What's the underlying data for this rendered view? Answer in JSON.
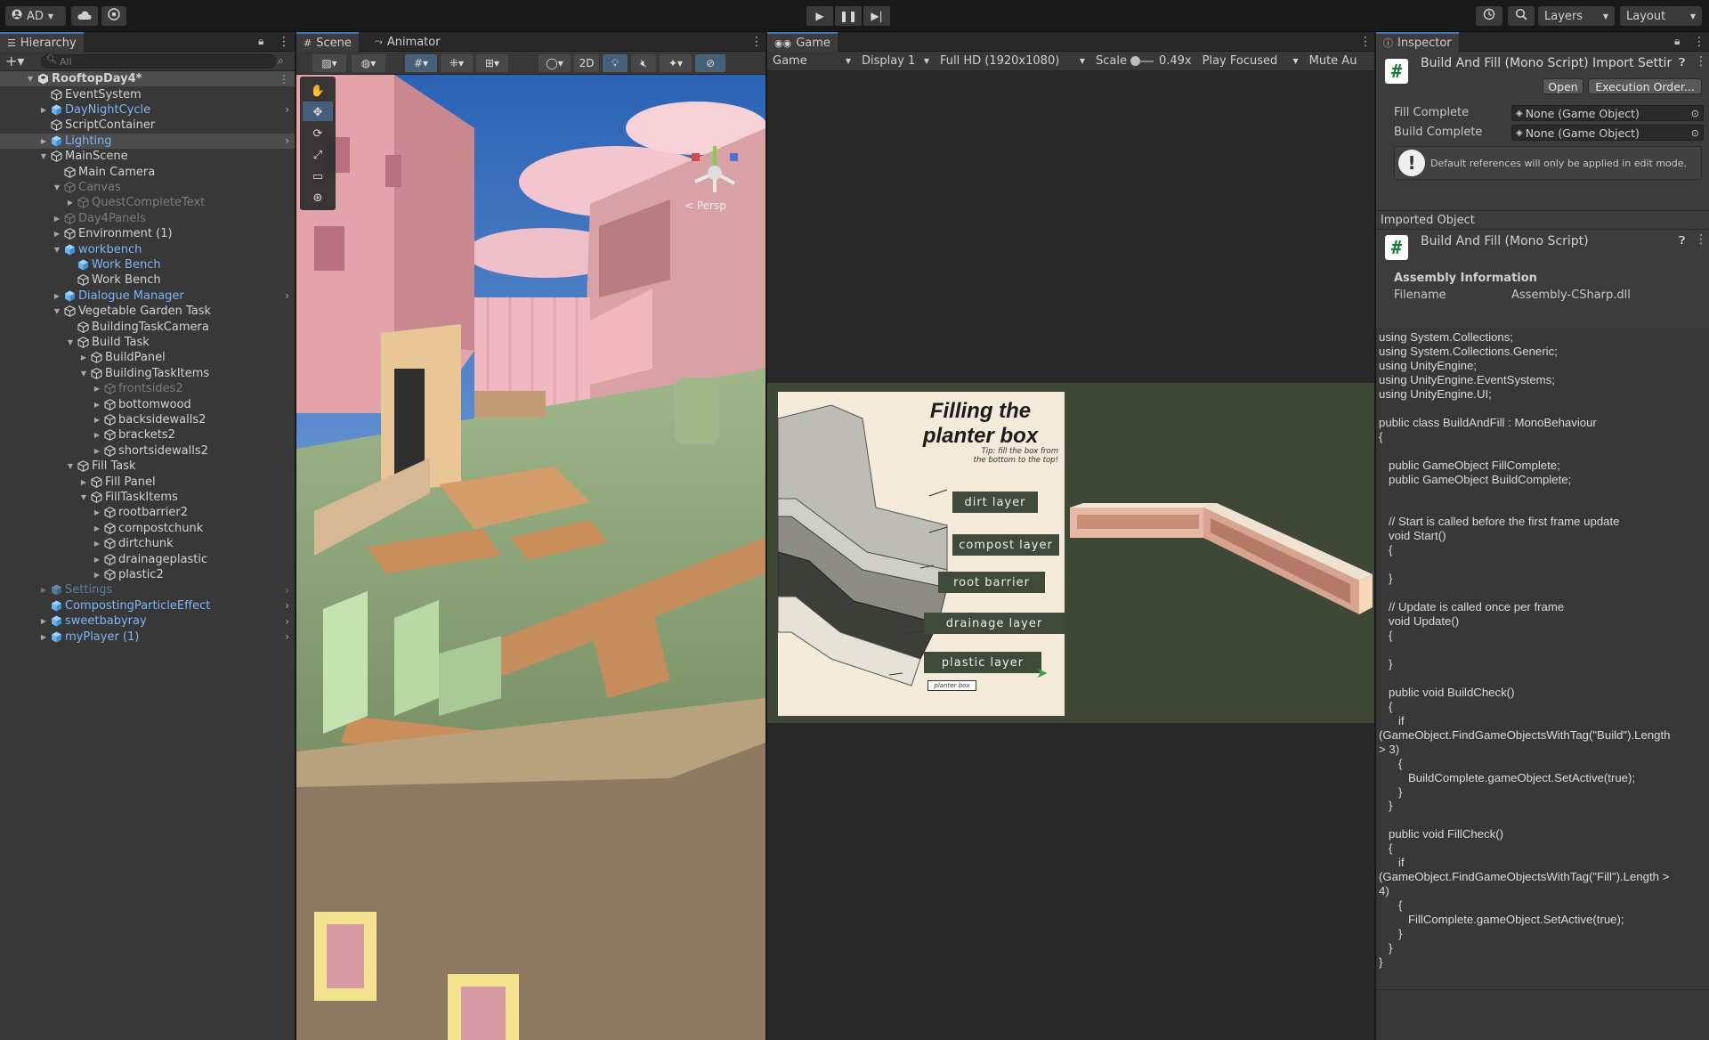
{
  "toolbar": {
    "account": "AD",
    "layers_label": "Layers",
    "layout_label": "Layout"
  },
  "hierarchy": {
    "tab_label": "Hierarchy",
    "search_placeholder": "All",
    "rows": [
      {
        "label": "RooftopDay4*",
        "depth": 0,
        "arrow": "down",
        "style": "scene",
        "chevron": false
      },
      {
        "label": "EventSystem",
        "depth": 1,
        "arrow": "",
        "style": "normal",
        "chevron": false
      },
      {
        "label": "DayNightCycle",
        "depth": 1,
        "arrow": "right",
        "style": "prefab",
        "chevron": true
      },
      {
        "label": "ScriptContainer",
        "depth": 1,
        "arrow": "",
        "style": "normal",
        "chevron": false
      },
      {
        "label": "Lighting",
        "depth": 1,
        "arrow": "right",
        "style": "prefab-sel",
        "chevron": true
      },
      {
        "label": "MainScene",
        "depth": 1,
        "arrow": "down",
        "style": "normal",
        "chevron": false
      },
      {
        "label": "Main Camera",
        "depth": 2,
        "arrow": "",
        "style": "normal",
        "chevron": false
      },
      {
        "label": "Canvas",
        "depth": 2,
        "arrow": "down",
        "style": "dim",
        "chevron": false
      },
      {
        "label": "QuestCompleteText",
        "depth": 3,
        "arrow": "right",
        "style": "dim",
        "chevron": false
      },
      {
        "label": "Day4Panels",
        "depth": 2,
        "arrow": "right",
        "style": "dim",
        "chevron": false
      },
      {
        "label": "Environment (1)",
        "depth": 2,
        "arrow": "right",
        "style": "normal",
        "chevron": false
      },
      {
        "label": "workbench",
        "depth": 2,
        "arrow": "down",
        "style": "prefab",
        "chevron": false
      },
      {
        "label": "Work Bench",
        "depth": 3,
        "arrow": "",
        "style": "prefab",
        "chevron": false
      },
      {
        "label": "Work Bench",
        "depth": 3,
        "arrow": "",
        "style": "normal",
        "chevron": false
      },
      {
        "label": "Dialogue Manager",
        "depth": 2,
        "arrow": "right",
        "style": "prefab",
        "chevron": true
      },
      {
        "label": "Vegetable Garden Task",
        "depth": 2,
        "arrow": "down",
        "style": "normal",
        "chevron": false
      },
      {
        "label": "BuildingTaskCamera",
        "depth": 3,
        "arrow": "",
        "style": "normal",
        "chevron": false
      },
      {
        "label": "Build Task",
        "depth": 3,
        "arrow": "down",
        "style": "normal",
        "chevron": false
      },
      {
        "label": "BuildPanel",
        "depth": 4,
        "arrow": "right",
        "style": "normal",
        "chevron": false
      },
      {
        "label": "BuildingTaskItems",
        "depth": 4,
        "arrow": "down",
        "style": "normal",
        "chevron": false
      },
      {
        "label": "frontsides2",
        "depth": 5,
        "arrow": "right",
        "style": "dim",
        "chevron": false
      },
      {
        "label": "bottomwood",
        "depth": 5,
        "arrow": "right",
        "style": "normal",
        "chevron": false
      },
      {
        "label": "backsidewalls2",
        "depth": 5,
        "arrow": "right",
        "style": "normal",
        "chevron": false
      },
      {
        "label": "brackets2",
        "depth": 5,
        "arrow": "right",
        "style": "normal",
        "chevron": false
      },
      {
        "label": "shortsidewalls2",
        "depth": 5,
        "arrow": "right",
        "style": "normal",
        "chevron": false
      },
      {
        "label": "Fill Task",
        "depth": 3,
        "arrow": "down",
        "style": "normal",
        "chevron": false
      },
      {
        "label": "Fill Panel",
        "depth": 4,
        "arrow": "right",
        "style": "normal",
        "chevron": false
      },
      {
        "label": "FillTaskItems",
        "depth": 4,
        "arrow": "down",
        "style": "normal",
        "chevron": false
      },
      {
        "label": "rootbarrier2",
        "depth": 5,
        "arrow": "right",
        "style": "normal",
        "chevron": false
      },
      {
        "label": "compostchunk",
        "depth": 5,
        "arrow": "right",
        "style": "normal",
        "chevron": false
      },
      {
        "label": "dirtchunk",
        "depth": 5,
        "arrow": "right",
        "style": "normal",
        "chevron": false
      },
      {
        "label": "drainageplastic",
        "depth": 5,
        "arrow": "right",
        "style": "normal",
        "chevron": false
      },
      {
        "label": "plastic2",
        "depth": 5,
        "arrow": "right",
        "style": "normal",
        "chevron": false
      },
      {
        "label": "Settings",
        "depth": 1,
        "arrow": "right",
        "style": "prefab-dim",
        "chevron": true
      },
      {
        "label": "CompostingParticleEffect",
        "depth": 1,
        "arrow": "",
        "style": "prefab",
        "chevron": true
      },
      {
        "label": "sweetbabyray",
        "depth": 1,
        "arrow": "right",
        "style": "prefab",
        "chevron": true
      },
      {
        "label": "myPlayer (1)",
        "depth": 1,
        "arrow": "right",
        "style": "prefab",
        "chevron": true
      }
    ]
  },
  "scene": {
    "tab_label": "Scene",
    "animator_tab": "Animator",
    "mode_2d": "2D",
    "persp_label": "< Persp"
  },
  "game": {
    "tab_label": "Game",
    "view_select": "Game",
    "display": "Display 1",
    "resolution": "Full HD (1920x1080)",
    "scale_label": "Scale",
    "scale_value": "0.49x",
    "play_mode": "Play Focused",
    "mute": "Mute Au",
    "card": {
      "title_line1": "Filling the",
      "title_line2": "planter box",
      "tip_line1": "Tip: fill the box from",
      "tip_line2": "the bottom to the top!",
      "layers": [
        "dirt layer",
        "compost layer",
        "root barrier",
        "drainage layer",
        "plastic layer"
      ],
      "box_label": "planter box"
    }
  },
  "inspector": {
    "tab_label": "Inspector",
    "title": "Build And Fill (Mono Script) Import Settir",
    "open_btn": "Open",
    "exec_btn": "Execution Order...",
    "fields": [
      {
        "label": "Fill Complete",
        "value": "None (Game Object)"
      },
      {
        "label": "Build Complete",
        "value": "None (Game Object)"
      }
    ],
    "info": "Default references will only be applied in edit mode.",
    "imported_header": "Imported Object",
    "imported_title": "Build And Fill (Mono Script)",
    "assembly_header": "Assembly Information",
    "filename_label": "Filename",
    "filename_value": "Assembly-CSharp.dll",
    "code": "using System.Collections;\nusing System.Collections.Generic;\nusing UnityEngine;\nusing UnityEngine.EventSystems;\nusing UnityEngine.UI;\n\npublic class BuildAndFill : MonoBehaviour\n{\n\n   public GameObject FillComplete;\n   public GameObject BuildComplete;\n\n\n   // Start is called before the first frame update\n   void Start()\n   {\n\n   }\n\n   // Update is called once per frame\n   void Update()\n   {\n\n   }\n\n   public void BuildCheck()\n   {\n      if\n(GameObject.FindGameObjectsWithTag(\"Build\").Length\n> 3)\n      {\n         BuildComplete.gameObject.SetActive(true);\n      }\n   }\n\n   public void FillCheck()\n   {\n      if\n(GameObject.FindGameObjectsWithTag(\"Fill\").Length >\n4)\n      {\n         FillComplete.gameObject.SetActive(true);\n      }\n   }\n}"
  },
  "colors": {
    "accent": "#3a79bb",
    "prefab_text": "#7fb4f5",
    "panel_bg": "#383838",
    "card_bg": "#f4ead9",
    "card_green": "#3f4a38",
    "game_bg": "#3f4737"
  }
}
